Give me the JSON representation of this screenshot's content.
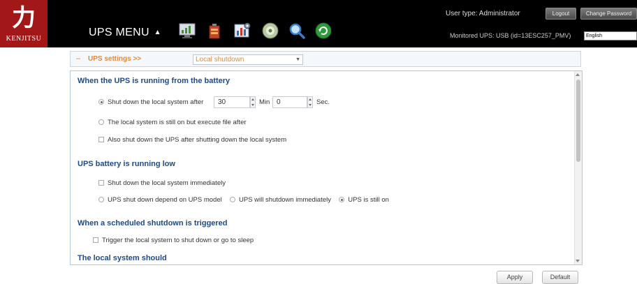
{
  "header": {
    "logo_text": "KENJITSU",
    "logo_glyph": "力",
    "menu_title": "UPS MENU",
    "menu_arrow": "▲",
    "icons": [
      "monitor-chart-icon",
      "battery-icon",
      "settings-chart-icon",
      "cd-disc-icon",
      "magnifier-icon",
      "refresh-icon"
    ],
    "user_type_label": "User type: Administrator",
    "logout_label": "Logout",
    "change_password_label": "Change Password",
    "monitored_label": "Monitored UPS: USB (id=13ESC257_PMV)",
    "language_value": "English"
  },
  "breadcrumb": {
    "dash": "–",
    "prefix": "UPS settings >>",
    "selected_page": "Local shutdown"
  },
  "sections": {
    "battery_running": {
      "title": "When the UPS is running from the battery",
      "shutdown_after_label": "Shut down the local system after",
      "min_value": "30",
      "min_label": "Min",
      "sec_value": "0",
      "sec_label": "Sec.",
      "execute_file_label": "The local system is still on but execute file after",
      "also_shutdown_label": "Also shut down the UPS after shutting down the local system"
    },
    "battery_low": {
      "title": "UPS battery is running low",
      "shutdown_immediately_label": "Shut down the local system immediately",
      "depend_model_label": "UPS shut down depend on UPS model",
      "will_shutdown_label": "UPS will shutdown immediately",
      "still_on_label": "UPS is still on"
    },
    "scheduled": {
      "title": "When a scheduled shutdown is triggered",
      "trigger_label": "Trigger the local system to shut down or go to sleep"
    },
    "local_system": {
      "title": "The local system should"
    }
  },
  "buttons": {
    "apply_label": "Apply",
    "default_label": "Default"
  },
  "colors": {
    "header_bg": "#000000",
    "logo_red": "#a21718",
    "section_title": "#1e4a88",
    "breadcrumb_orange": "#e08a3c"
  }
}
